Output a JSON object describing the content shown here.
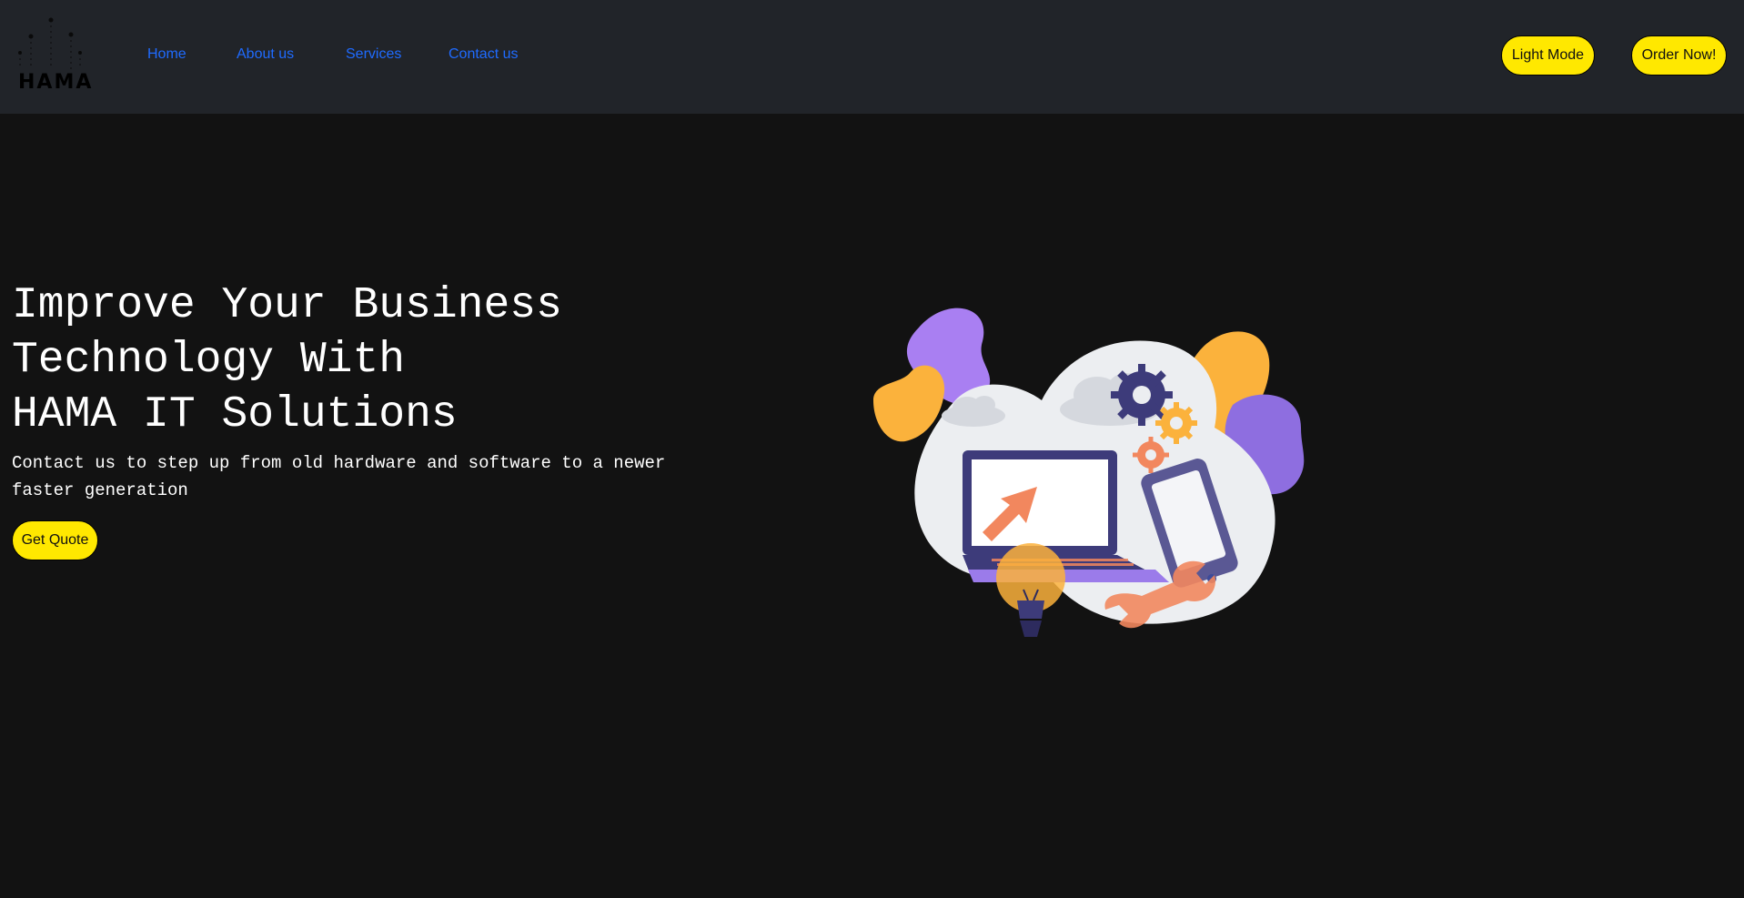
{
  "brand": {
    "logo_text": "HAMA"
  },
  "nav": {
    "items": [
      {
        "label": "Home"
      },
      {
        "label": "About us"
      },
      {
        "label": "Services"
      },
      {
        "label": "Contact us"
      }
    ],
    "light_mode_label": "Light Mode",
    "order_label": "Order Now!"
  },
  "hero": {
    "title_lines": [
      "Improve Your Business",
      "Technology With",
      "HAMA IT Solutions"
    ],
    "subtitle": "Contact us to step up from old hardware and software to a newer faster generation",
    "cta_label": "Get Quote"
  },
  "colors": {
    "nav_bg": "#212429",
    "page_bg": "#121212",
    "link": "#1f6bff",
    "accent_yellow": "#ffe800",
    "illustration_purple": "#9b7bea",
    "illustration_orange": "#fbb23c",
    "illustration_navy": "#3d3b7a",
    "illustration_coral": "#f2875e"
  },
  "icons": {
    "logo": "hama-logo-mark",
    "illustration": "it-services-illustration"
  }
}
